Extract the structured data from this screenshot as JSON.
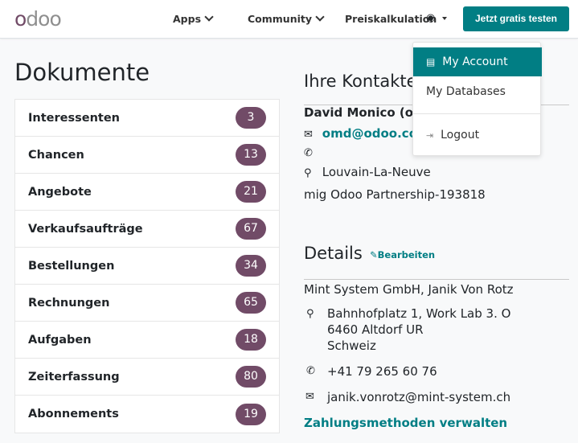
{
  "header": {
    "logo": "odoo",
    "nav": [
      {
        "label": "Apps"
      },
      {
        "label": "Community"
      },
      {
        "label": "Preiskalkulation"
      }
    ],
    "cta": "Jetzt gratis testen"
  },
  "dropdown": {
    "items": [
      {
        "label": "My Account",
        "icon": "id-card-icon",
        "active": true
      },
      {
        "label": "My Databases"
      },
      {
        "label": "Logout",
        "icon": "sign-out-icon"
      }
    ]
  },
  "documents": {
    "title": "Dokumente",
    "items": [
      {
        "label": "Interessenten",
        "count": "3"
      },
      {
        "label": "Chancen",
        "count": "13"
      },
      {
        "label": "Angebote",
        "count": "21"
      },
      {
        "label": "Verkaufsaufträge",
        "count": "67"
      },
      {
        "label": "Bestellungen",
        "count": "34"
      },
      {
        "label": "Rechnungen",
        "count": "65"
      },
      {
        "label": "Aufgaben",
        "count": "18"
      },
      {
        "label": "Zeiterfassung",
        "count": "80"
      },
      {
        "label": "Abonnements",
        "count": "19"
      }
    ]
  },
  "contact": {
    "title": "Ihre Kontakte",
    "name": "David Monico (om",
    "email": "omd@odoo.co",
    "phone": "",
    "city": "Louvain-La-Neuve",
    "partnership": "mig Odoo Partnership-193818"
  },
  "details": {
    "title": "Details",
    "edit": "Bearbeiten",
    "company": "Mint System GmbH, Janik Von Rotz",
    "address": [
      "Bahnhofplatz 1, Work Lab 3. O",
      "6460 Altdorf UR",
      "Schweiz"
    ],
    "phone": "+41 79 265 60 76",
    "email": "janik.vonrotz@mint-system.ch",
    "payment_link": "Zahlungsmethoden verwalten"
  },
  "colors": {
    "brand": "#714b67",
    "accent": "#017e84"
  }
}
